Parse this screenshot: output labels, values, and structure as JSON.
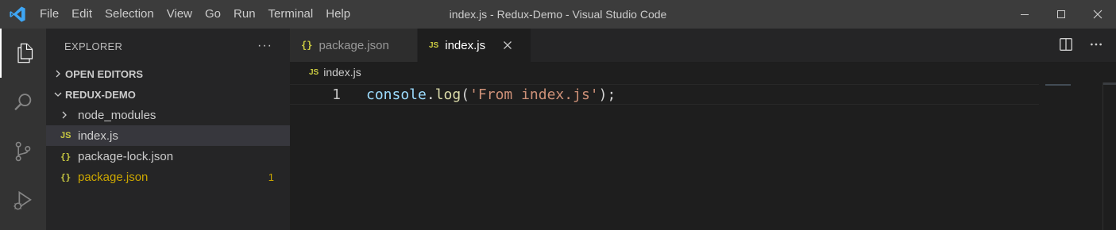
{
  "window": {
    "title": "index.js - Redux-Demo - Visual Studio Code"
  },
  "menu": [
    "File",
    "Edit",
    "Selection",
    "View",
    "Go",
    "Run",
    "Terminal",
    "Help"
  ],
  "activity_bar": {
    "items": [
      "explorer-icon",
      "search-icon",
      "source-control-icon",
      "run-debug-icon"
    ],
    "active": "explorer-icon"
  },
  "sidebar": {
    "title": "EXPLORER",
    "more": "···",
    "sections": {
      "open_editors": "OPEN EDITORS",
      "project": "REDUX-DEMO"
    },
    "tree": [
      {
        "name": "node_modules",
        "type": "folder",
        "icon": "",
        "selected": false,
        "modified": false,
        "badge": ""
      },
      {
        "name": "index.js",
        "type": "file",
        "icon": "JS",
        "selected": true,
        "modified": false,
        "badge": ""
      },
      {
        "name": "package-lock.json",
        "type": "file",
        "icon": "{}",
        "selected": false,
        "modified": false,
        "badge": ""
      },
      {
        "name": "package.json",
        "type": "file",
        "icon": "{}",
        "selected": false,
        "modified": true,
        "badge": "1"
      }
    ]
  },
  "tabs": [
    {
      "label": "package.json",
      "icon": "{}",
      "active": false
    },
    {
      "label": "index.js",
      "icon": "JS",
      "active": true
    }
  ],
  "breadcrumb": {
    "icon": "JS",
    "file": "index.js"
  },
  "editor": {
    "lines": [
      {
        "number": "1",
        "tokens": {
          "obj": "console",
          "dot": ".",
          "fn": "log",
          "open": "(",
          "str": "'From index.js'",
          "close": ")",
          "semi": ";"
        }
      }
    ]
  },
  "colors": {
    "accent": "#007acc",
    "titlebar": "#3c3c3c",
    "activitybar": "#333333",
    "sidebar": "#252526",
    "editor": "#1e1e1e",
    "modified": "#cca700",
    "json_icon": "#cbcb41",
    "js_icon": "#cbcb41",
    "string": "#ce9178",
    "function": "#dcdcaa",
    "variable": "#9cdcfe"
  }
}
